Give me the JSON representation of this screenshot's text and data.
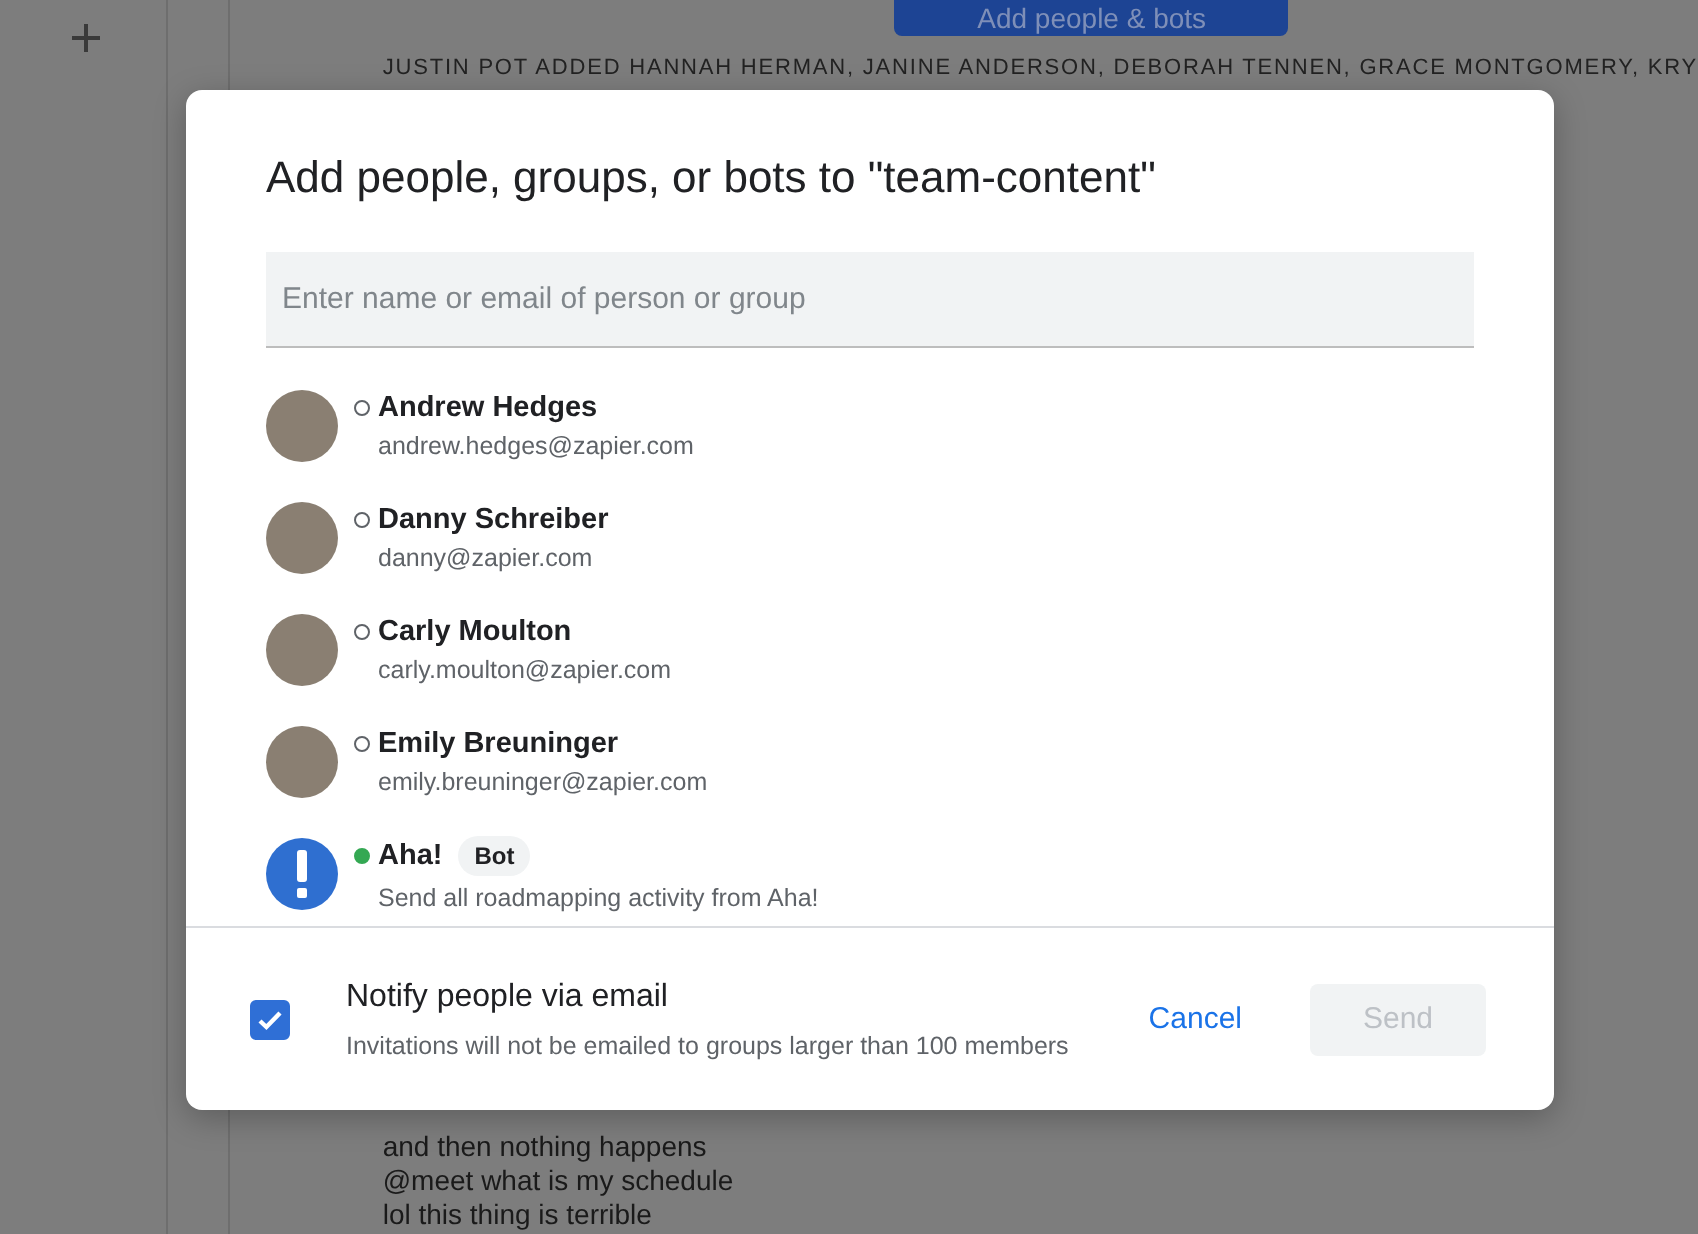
{
  "background": {
    "add_button": "Add people & bots",
    "system_message": "JUSTIN POT ADDED HANNAH HERMAN, JANINE ANDERSON, DEBORAH TENNEN, GRACE MONTGOMERY, KRY",
    "messages": [
      "and then nothing happens",
      "@meet what is my schedule",
      "lol this thing is terrible"
    ]
  },
  "dialog": {
    "title": "Add people, groups, or bots to \"team-content\"",
    "search": {
      "placeholder": "Enter name or email of person or group"
    },
    "people": [
      {
        "kind": "person",
        "name": "Andrew Hedges",
        "detail": "andrew.hedges@zapier.com",
        "online": false
      },
      {
        "kind": "person",
        "name": "Danny Schreiber",
        "detail": "danny@zapier.com",
        "online": false
      },
      {
        "kind": "person",
        "name": "Carly Moulton",
        "detail": "carly.moulton@zapier.com",
        "online": false
      },
      {
        "kind": "person",
        "name": "Emily Breuninger",
        "detail": "emily.breuninger@zapier.com",
        "online": false
      },
      {
        "kind": "bot",
        "name": "Aha!",
        "badge": "Bot",
        "detail": "Send all roadmapping activity from Aha!",
        "online": true
      }
    ],
    "notify": {
      "label": "Notify people via email",
      "note": "Invitations will not be emailed to groups larger than 100 members",
      "checked": true
    },
    "cancel": "Cancel",
    "send": {
      "label": "Send",
      "disabled": true
    }
  }
}
